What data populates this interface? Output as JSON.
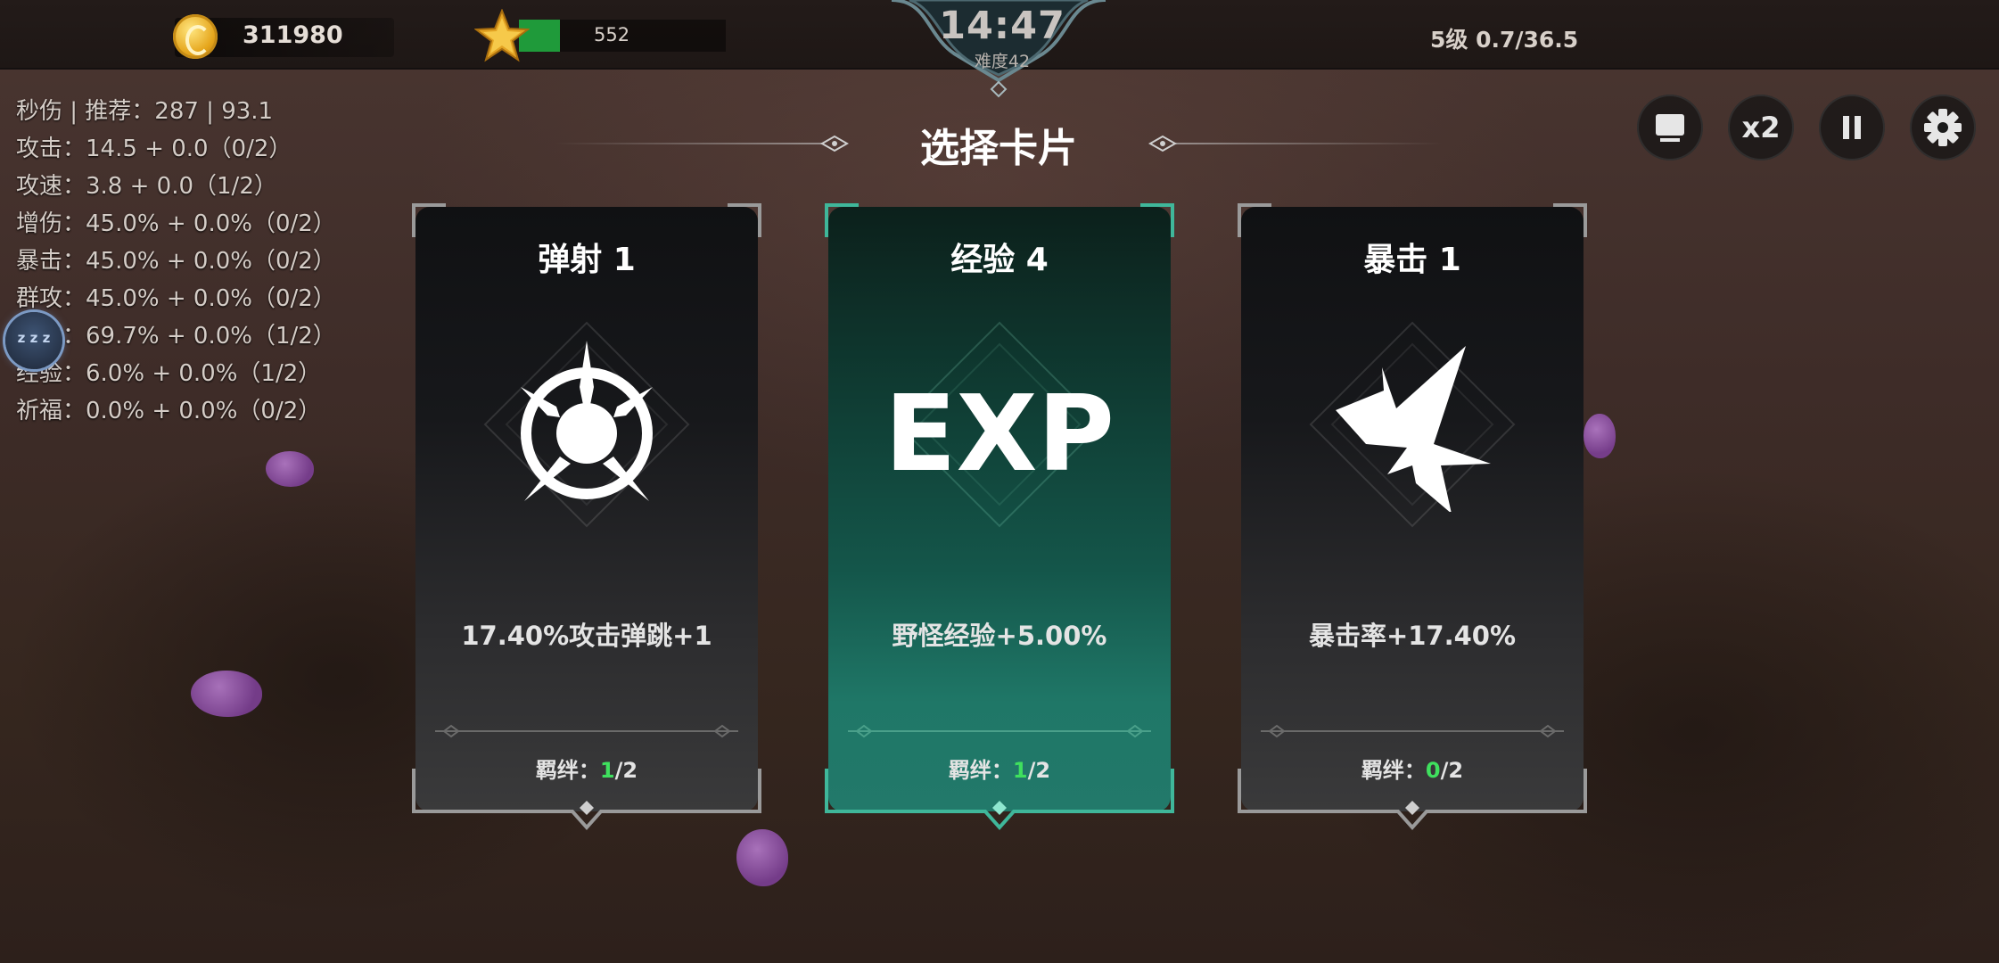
{
  "topbar": {
    "coins": "311980",
    "xp_value": "552",
    "xp_progress": 0.2,
    "timer": "14:47",
    "difficulty": "难度42",
    "level_info": "5级 0.7/36.5"
  },
  "stats": [
    "秒伤 | 推荐：287 | 93.1",
    "攻击：14.5 + 0.0（0/2）",
    "攻速：3.8 + 0.0（1/2）",
    "增伤：45.0% + 0.0%（0/2）",
    "暴击：45.0% + 0.0%（0/2）",
    "群攻：45.0% + 0.0%（0/2）",
    "弹射：69.7% + 0.0%（1/2）",
    "经验：6.0% + 0.0%（1/2）",
    "祈福：0.0% + 0.0%（0/2）"
  ],
  "title": "选择卡片",
  "buttons": {
    "speed_label": "x2",
    "screen_icon": "monitor-icon",
    "pause_icon": "pause-icon",
    "settings_icon": "gear-icon"
  },
  "bond_label": "羁绊：",
  "cards": [
    {
      "title": "弹射 1",
      "icon": "ricochet-icon",
      "description": "17.40%攻击弹跳+1",
      "bond_current": "1",
      "bond_total": "/2",
      "selected": false
    },
    {
      "title": "经验 4",
      "icon_text": "EXP",
      "description": "野怪经验+5.00%",
      "bond_current": "1",
      "bond_total": "/2",
      "selected": true
    },
    {
      "title": "暴击 1",
      "icon": "critical-burst-icon",
      "description": "暴击率+17.40%",
      "bond_current": "0",
      "bond_total": "/2",
      "selected": false
    }
  ],
  "colors": {
    "accent_selected": "#3fb79a",
    "bond_current": "#3fe05e",
    "xp_bar": "#1f9a3a",
    "coin": "#e5a51b"
  }
}
